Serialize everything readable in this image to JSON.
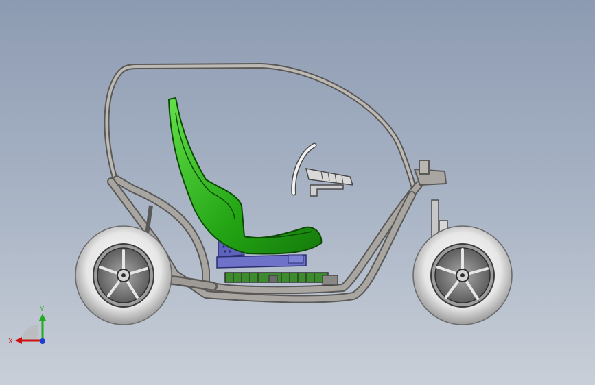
{
  "viewport": {
    "background_top": "#8d9bb2",
    "background_bottom": "#c9cfd8"
  },
  "model": {
    "frame_color": "#8a8784",
    "seat_color": "#2fb81c",
    "seat_base_color": "#6e72c9",
    "tire_color": "#e3e3e3",
    "wheel_color": "#7d7d7d"
  },
  "triad": {
    "x_label": "X",
    "y_label": "Y",
    "x_color": "#cc1111",
    "y_color": "#22aa22",
    "z_color": "#1a3fd1"
  }
}
